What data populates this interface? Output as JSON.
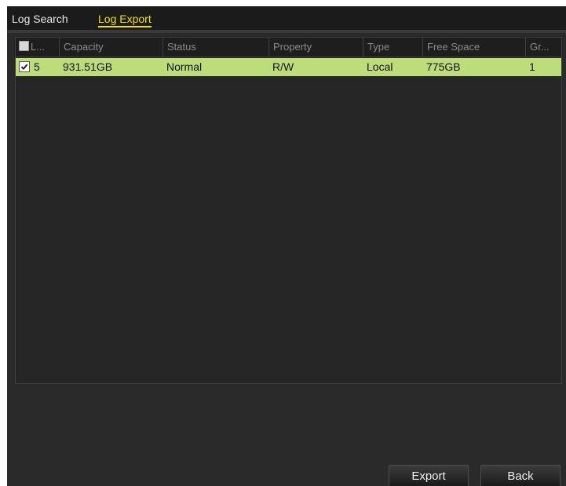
{
  "tabs": [
    {
      "label": "Log Search"
    },
    {
      "label": "Log Export"
    }
  ],
  "table": {
    "columns": [
      "L...",
      "Capacity",
      "Status",
      "Property",
      "Type",
      "Free Space",
      "Gr..."
    ],
    "rows": [
      {
        "checked": true,
        "label": "5",
        "capacity": "931.51GB",
        "status": "Normal",
        "property": "R/W",
        "type": "Local",
        "free_space": "775GB",
        "group": "1"
      }
    ]
  },
  "buttons": {
    "export": "Export",
    "back": "Back"
  },
  "colors": {
    "selected_row": "#bddc7a",
    "active_tab": "#f0e000"
  }
}
